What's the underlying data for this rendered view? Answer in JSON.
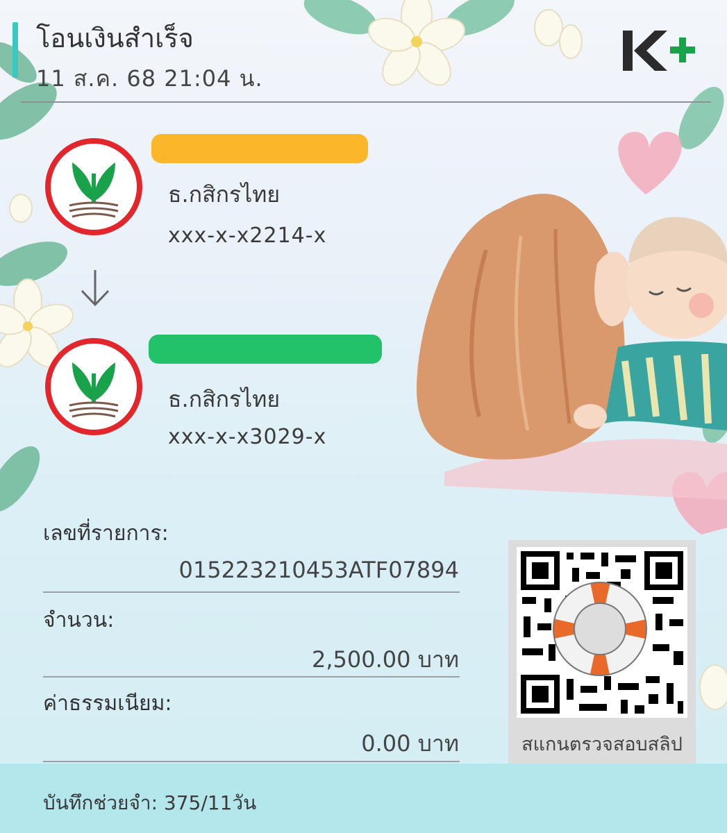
{
  "header": {
    "title": "โอนเงินสำเร็จ",
    "datetime": "11 ส.ค. 68  21:04 น.",
    "logo_icon": "k-plus-logo"
  },
  "sender": {
    "bank": "ธ.กสิกรไทย",
    "account": "xxx-x-x2214-x",
    "name_redaction_color": "#fbb629",
    "logo_icon": "kasikorn-bank-logo"
  },
  "transfer_arrow_icon": "arrow-down-icon",
  "receiver": {
    "bank": "ธ.กสิกรไทย",
    "account": "xxx-x-x3029-x",
    "name_redaction_color": "#22c26a",
    "logo_icon": "kasikorn-bank-logo"
  },
  "details": {
    "ref_label": "เลขที่รายการ:",
    "ref_value": "015223210453ATF07894",
    "amount_label": "จำนวน:",
    "amount_value": "2,500.00 บาท",
    "fee_label": "ค่าธรรมเนียม:",
    "fee_value": "0.00 บาท"
  },
  "qr": {
    "caption": "สแกนตรวจสอบสลิป",
    "overlay_icon": "lifebuoy-icon"
  },
  "footer": {
    "memo": "บันทึกช่วยจำ: 375/11วัน"
  },
  "colors": {
    "accent": "#39c9c0",
    "kbank_green": "#1aa24a",
    "kbank_red": "#e3262b",
    "footer_bg": "#b4e7ec"
  }
}
